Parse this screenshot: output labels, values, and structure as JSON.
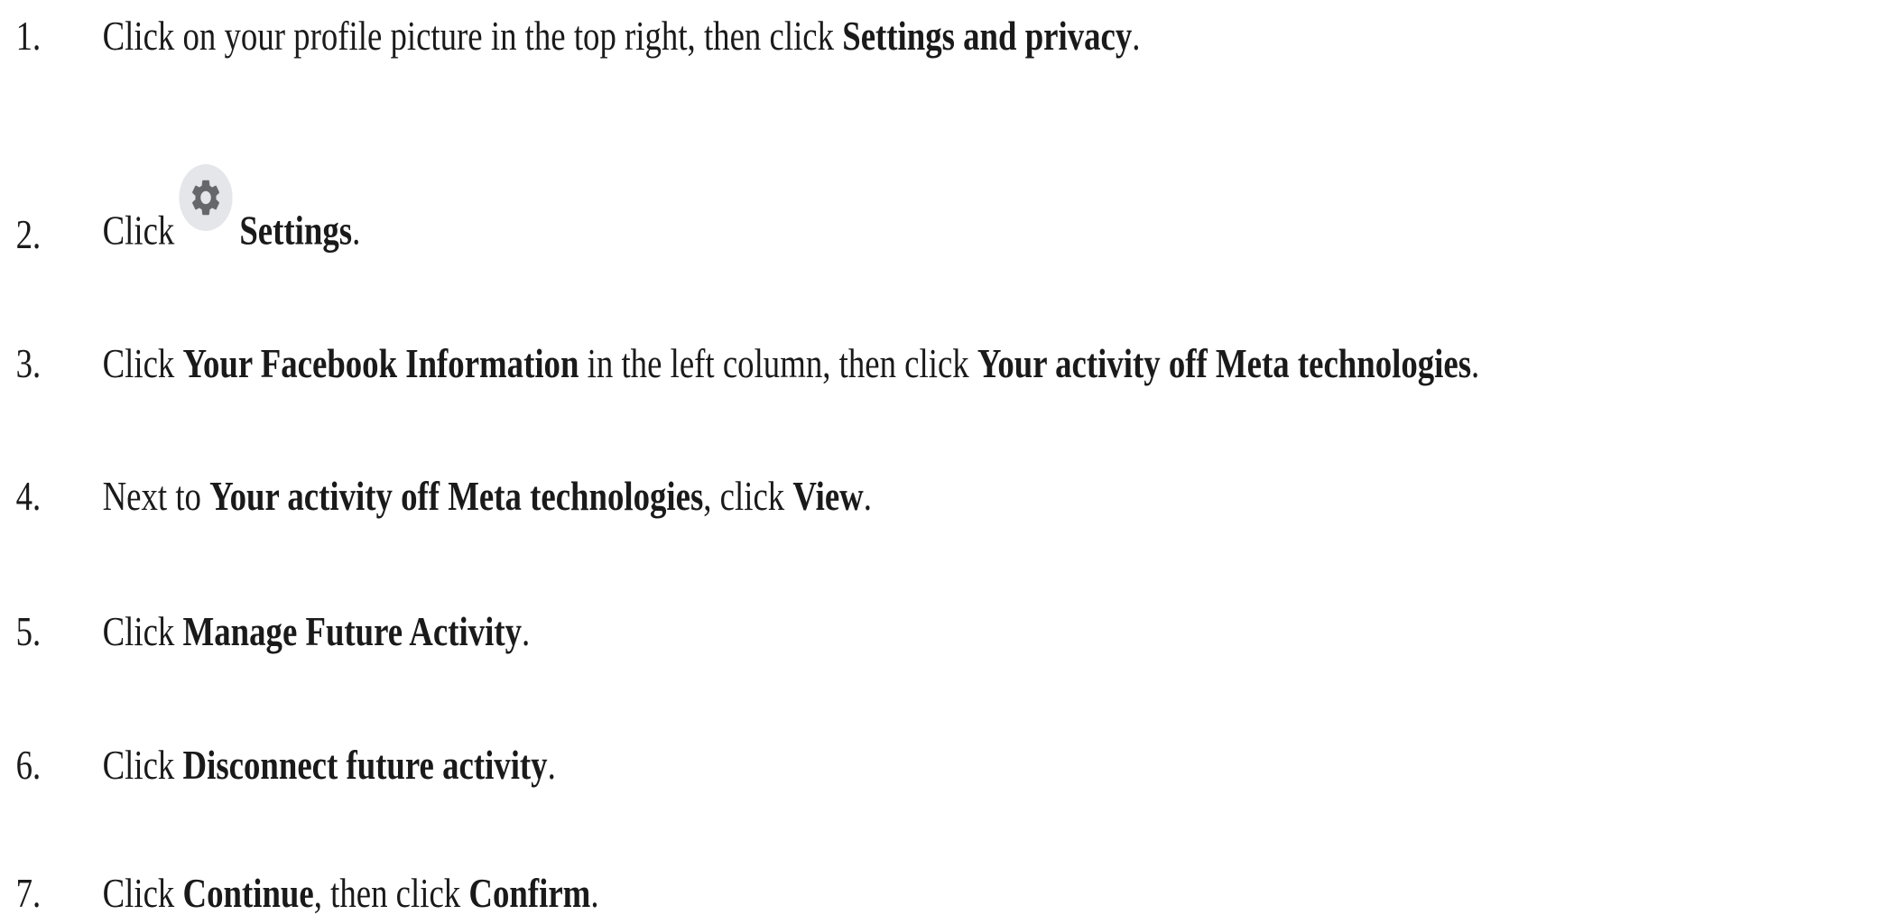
{
  "steps": [
    {
      "number": "1.",
      "parts": [
        {
          "t": "Click on your profile picture in the top right, then click "
        },
        {
          "t": "Settings and privacy",
          "b": true
        },
        {
          "t": "."
        }
      ]
    },
    {
      "number": "2.",
      "before_icon": "Click",
      "icon": "gear-icon",
      "parts": [
        {
          "t": "Settings",
          "b": true
        },
        {
          "t": "."
        }
      ]
    },
    {
      "number": "3.",
      "parts": [
        {
          "t": "Click "
        },
        {
          "t": "Your Facebook Information",
          "b": true
        },
        {
          "t": " in the left column, then click "
        },
        {
          "t": "Your activity off Meta technologies",
          "b": true
        },
        {
          "t": "."
        }
      ]
    },
    {
      "number": "4.",
      "parts": [
        {
          "t": "Next to "
        },
        {
          "t": "Your activity off Meta technologies",
          "b": true
        },
        {
          "t": ", click "
        },
        {
          "t": "View",
          "b": true
        },
        {
          "t": "."
        }
      ]
    },
    {
      "number": "5.",
      "parts": [
        {
          "t": "Click "
        },
        {
          "t": "Manage Future Activity",
          "b": true
        },
        {
          "t": "."
        }
      ]
    },
    {
      "number": "6.",
      "parts": [
        {
          "t": "Click "
        },
        {
          "t": "Disconnect future activity",
          "b": true
        },
        {
          "t": "."
        }
      ]
    },
    {
      "number": "7.",
      "parts": [
        {
          "t": "Click "
        },
        {
          "t": "Continue",
          "b": true
        },
        {
          "t": ", then click "
        },
        {
          "t": "Confirm",
          "b": true
        },
        {
          "t": "."
        }
      ]
    }
  ],
  "colors": {
    "text": "#1a1a1a",
    "icon_background": "#e4e6ea",
    "icon_glyph": "#65676b"
  }
}
